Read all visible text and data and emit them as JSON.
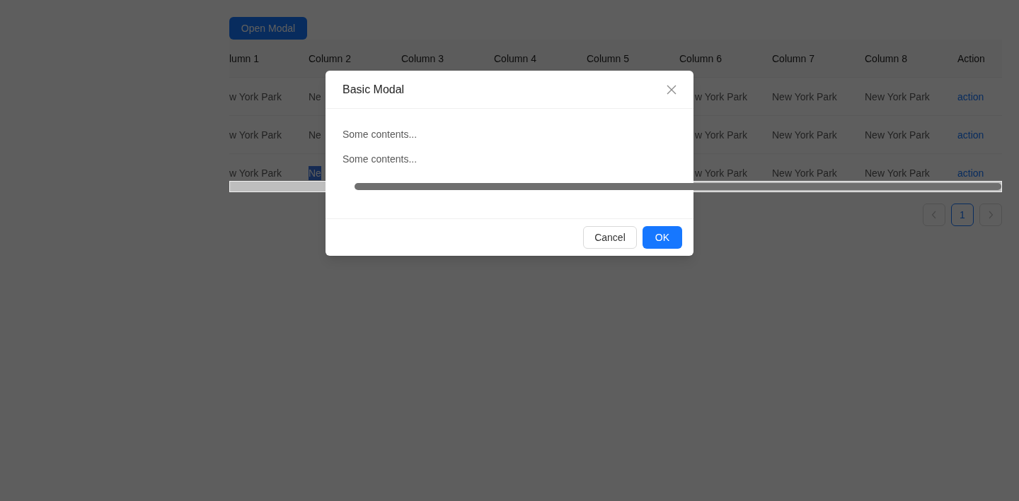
{
  "open_button": "Open Modal",
  "table": {
    "columns": [
      "lumn 1",
      "Column 2",
      "Column 3",
      "Column 4",
      "Column 5",
      "Column 6",
      "Column 7",
      "Column 8",
      "Action"
    ],
    "rows": [
      {
        "cells": [
          {
            "kind": "text",
            "text": "w York Park"
          },
          {
            "kind": "text",
            "text": "Ne"
          },
          {
            "kind": "empty"
          },
          {
            "kind": "empty"
          },
          {
            "kind": "empty"
          },
          {
            "kind": "text",
            "text": "w York Park"
          },
          {
            "kind": "text",
            "text": "New York Park"
          },
          {
            "kind": "text",
            "text": "New York Park"
          },
          {
            "kind": "link",
            "text": "action"
          }
        ]
      },
      {
        "cells": [
          {
            "kind": "text",
            "text": "w York Park"
          },
          {
            "kind": "text",
            "text": "Ne"
          },
          {
            "kind": "empty"
          },
          {
            "kind": "empty"
          },
          {
            "kind": "empty"
          },
          {
            "kind": "text",
            "text": "w York Park"
          },
          {
            "kind": "text",
            "text": "New York Park"
          },
          {
            "kind": "text",
            "text": "New York Park"
          },
          {
            "kind": "link",
            "text": "action"
          }
        ]
      },
      {
        "cells": [
          {
            "kind": "text",
            "text": "w York Park"
          },
          {
            "kind": "selection",
            "text": "Ne"
          },
          {
            "kind": "empty"
          },
          {
            "kind": "empty"
          },
          {
            "kind": "empty"
          },
          {
            "kind": "text",
            "text": "w York Park"
          },
          {
            "kind": "text",
            "text": "New York Park"
          },
          {
            "kind": "text",
            "text": "New York Park"
          },
          {
            "kind": "link",
            "text": "action"
          }
        ]
      }
    ]
  },
  "pagination": {
    "previous": {
      "disabled": true
    },
    "pages": [
      {
        "label": "1",
        "selected": true
      }
    ],
    "next": {
      "disabled": true
    }
  },
  "modal": {
    "title": "Basic Modal",
    "lines": [
      "Some contents...",
      "Some contents..."
    ],
    "buttons": [
      {
        "label": "Cancel",
        "kind": "default"
      },
      {
        "label": "OK",
        "kind": "primary"
      }
    ]
  }
}
